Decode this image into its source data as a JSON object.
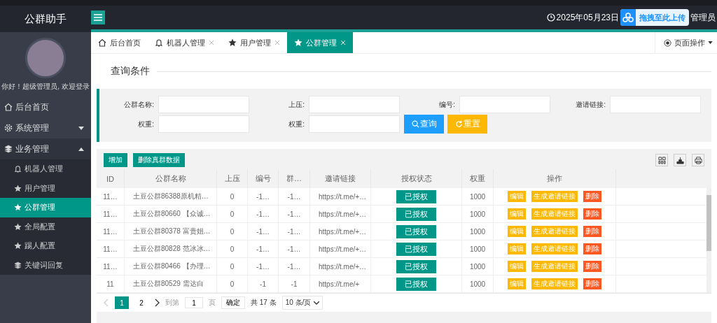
{
  "app": {
    "title": "公群助手"
  },
  "header": {
    "date": "2025年05月23日",
    "upload_widget": "拖拽至此上传",
    "user": "管理员"
  },
  "sidebar": {
    "greeting": "你好！超级管理员, 欢迎登录",
    "items": [
      {
        "label": "后台首页",
        "selected": false
      },
      {
        "label": "系统管理",
        "selected": false,
        "expanded": false
      },
      {
        "label": "业务管理",
        "selected": false,
        "expanded": true,
        "children": [
          {
            "label": "机器人管理",
            "selected": false
          },
          {
            "label": "用户管理",
            "selected": false
          },
          {
            "label": "公群管理",
            "selected": true
          },
          {
            "label": "全局配置",
            "selected": false
          },
          {
            "label": "踢人配置",
            "selected": false
          },
          {
            "label": "关键词回复",
            "selected": false
          }
        ]
      }
    ]
  },
  "tabs": [
    {
      "label": "后台首页",
      "selected": false,
      "closable": false
    },
    {
      "label": "机器人管理",
      "selected": false,
      "closable": true
    },
    {
      "label": "用户管理",
      "selected": false,
      "closable": true
    },
    {
      "label": "公群管理",
      "selected": true,
      "closable": true
    }
  ],
  "page_actions": "页面操作",
  "query": {
    "title": "查询条件",
    "fields": [
      {
        "label": "公群名称:"
      },
      {
        "label": "上压:"
      },
      {
        "label": "编号:"
      },
      {
        "label": "邀请链接:"
      },
      {
        "label": "权重:"
      },
      {
        "label": "权重:"
      }
    ],
    "buttons": [
      {
        "label": "查询",
        "kind": "search"
      },
      {
        "label": "重置",
        "kind": "reset"
      }
    ]
  },
  "toolbar": {
    "buttons": [
      "增加",
      "删除真群数据"
    ]
  },
  "table": {
    "columns": [
      "ID",
      "公群名称",
      "上压",
      "编号",
      "群…",
      "邀请链接",
      "授权状态",
      "权重",
      "操作"
    ],
    "rows": [
      {
        "cells": [
          "11…",
          "土豆公群86388原机精…",
          "0",
          "-1…",
          "-1…",
          "https://t.me/+…"
        ],
        "status": "已授权",
        "weight": "1000",
        "actions": [
          "编辑",
          "生成邀请链接",
          "删除"
        ]
      },
      {
        "cells": [
          "11…",
          "土豆公群80660 【众诚…",
          "0",
          "-1…",
          "-1…",
          "https://t.me/+…"
        ],
        "status": "已授权",
        "weight": "1000",
        "actions": [
          "编辑",
          "生成邀请链接",
          "删除"
        ]
      },
      {
        "cells": [
          "11…",
          "土豆公群80378 富贵姐…",
          "0",
          "-1…",
          "-1…",
          "https://t.me/+…"
        ],
        "status": "已授权",
        "weight": "1000",
        "actions": [
          "编辑",
          "生成邀请链接",
          "删除"
        ]
      },
      {
        "cells": [
          "11…",
          "土豆公群80828 范冰冰…",
          "0",
          "-1…",
          "-1…",
          "https://t.me/+…"
        ],
        "status": "已授权",
        "weight": "1000",
        "actions": [
          "编辑",
          "生成邀请链接",
          "删除"
        ]
      },
      {
        "cells": [
          "11…",
          "土豆公群80466 【办理…",
          "0",
          "-1…",
          "-1…",
          "https://t.me/+…"
        ],
        "status": "已授权",
        "weight": "1000",
        "actions": [
          "编辑",
          "生成邀请链接",
          "删除"
        ]
      },
      {
        "cells": [
          "11",
          "土豆公群80529 需达白",
          "0",
          "-1",
          "-1",
          "https://t.me/+"
        ],
        "status": "已授权",
        "weight": "1000",
        "actions": [
          "编辑",
          "生成邀请链接",
          "删除"
        ]
      }
    ]
  },
  "pager": {
    "pages": [
      {
        "label": "1",
        "selected": true
      },
      {
        "label": "2",
        "selected": false
      }
    ],
    "goto_label": "到第",
    "goto_value": "1",
    "page_unit": "页",
    "confirm": "确定",
    "total": "共 17 条",
    "page_size": "10 条/页"
  }
}
